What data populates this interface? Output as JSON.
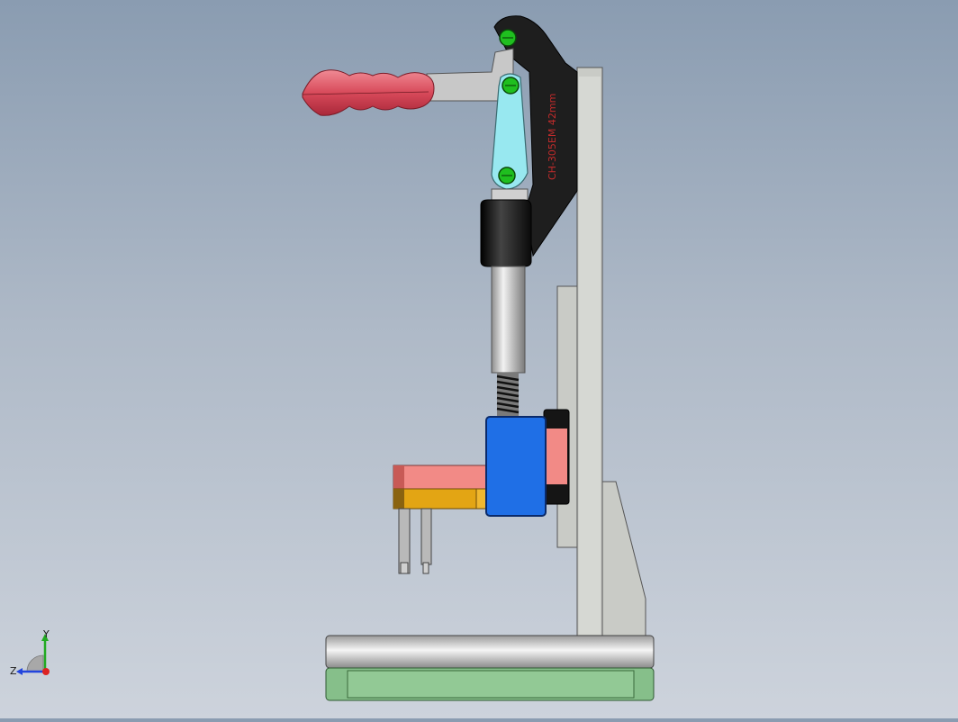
{
  "viewport": {
    "title": "",
    "background_top": "#8a9cb1",
    "background_bottom": "#cdd3dc"
  },
  "model": {
    "clamp_body_text": "CH-305EM 42mm",
    "parts": [
      {
        "name": "handle-grip",
        "color": "#d9505f"
      },
      {
        "name": "clamp-lever-arm",
        "color": "#c9c9c9"
      },
      {
        "name": "clamp-body",
        "color": "#1e1e1e"
      },
      {
        "name": "link-plate",
        "color": "#98e8f0"
      },
      {
        "name": "pivot-pins",
        "color": "#1fbf1f"
      },
      {
        "name": "plunger-sleeve",
        "color": "#121212"
      },
      {
        "name": "plunger-rod",
        "color": "#d4d4d4"
      },
      {
        "name": "spring",
        "color": "#222222"
      },
      {
        "name": "slider-block",
        "color": "#1f6fe6"
      },
      {
        "name": "pad-upper",
        "color": "#f28a86"
      },
      {
        "name": "pad-lower",
        "color": "#e3a514"
      },
      {
        "name": "probe-pins",
        "color": "#b9b9b9"
      },
      {
        "name": "column",
        "color": "#c9cbc6"
      },
      {
        "name": "gusset",
        "color": "#c9cbc6"
      },
      {
        "name": "base-plate",
        "color": "#d8d8d8"
      },
      {
        "name": "base-foot",
        "color": "#86bf8a"
      }
    ]
  },
  "triad": {
    "x_label": "",
    "y_label": "Y",
    "z_label": "Z",
    "y_color": "#22aa22",
    "z_color": "#2244dd",
    "x_color": "#dd2222"
  }
}
